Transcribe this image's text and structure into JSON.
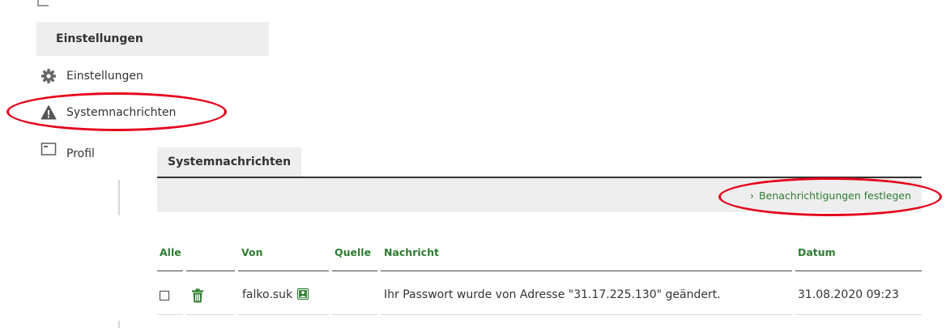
{
  "sidebar": {
    "header": "Einstellungen",
    "items": [
      {
        "label": "Einstellungen",
        "icon": "gear-icon"
      },
      {
        "label": "Systemnachrichten",
        "icon": "warning-icon"
      },
      {
        "label": "Profil",
        "icon": "profile-card-icon"
      }
    ]
  },
  "panel": {
    "tab_label": "Systemnachrichten",
    "toolbar_link": "Benachrichtigungen festlegen",
    "toolbar_link_icon": "chevron-right-icon"
  },
  "table": {
    "headers": {
      "all": "Alle",
      "from": "Von",
      "source": "Quelle",
      "message": "Nachricht",
      "date": "Datum"
    },
    "rows": [
      {
        "checked": false,
        "from": "falko.suk",
        "message": "Ihr Passwort wurde von Adresse \"31.17.225.130\" geändert.",
        "date": "31.08.2020 09:23"
      }
    ]
  },
  "colors": {
    "accent_green": "#2e7d32",
    "highlight_red": "#e5001a",
    "panel_grey": "#eeeeee",
    "text": "#333333"
  }
}
